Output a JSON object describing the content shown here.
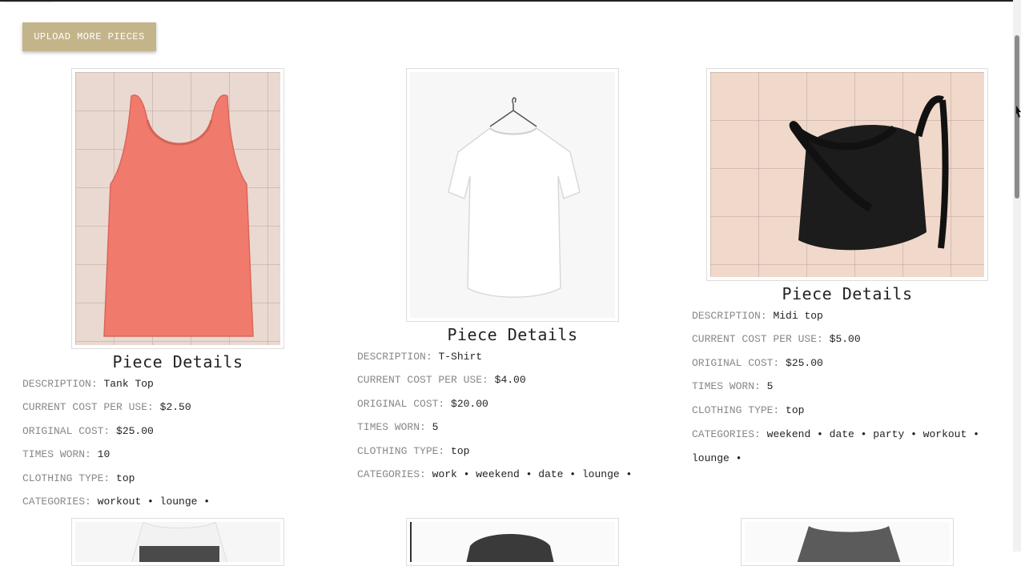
{
  "toolbar": {
    "upload_label": "UPLOAD MORE PIECES"
  },
  "labels": {
    "description": "DESCRIPTION:",
    "cost_per_use": "CURRENT COST PER USE:",
    "original_cost": "ORIGINAL COST:",
    "times_worn": "TIMES WORN:",
    "clothing_type": "CLOTHING TYPE:",
    "categories": "CATEGORIES:"
  },
  "pieces": [
    {
      "title": "Piece Details",
      "image_icon": "tank-top-photo",
      "description": "Tank Top",
      "cost_per_use": "$2.50",
      "original_cost": "$25.00",
      "times_worn": "10",
      "clothing_type": "top",
      "categories": "workout • lounge •"
    },
    {
      "title": "Piece Details",
      "image_icon": "tshirt-photo",
      "description": "T-Shirt",
      "cost_per_use": "$4.00",
      "original_cost": "$20.00",
      "times_worn": "5",
      "clothing_type": "top",
      "categories": "work • weekend • date • lounge •"
    },
    {
      "title": "Piece Details",
      "image_icon": "midi-top-photo",
      "description": "Midi top",
      "cost_per_use": "$5.00",
      "original_cost": "$25.00",
      "times_worn": "5",
      "clothing_type": "top",
      "categories": "weekend • date • party • workout • lounge •"
    }
  ],
  "colors": {
    "button": "#c4b48a",
    "tank": "#f07a6c",
    "midi": "#1c1c1c",
    "bed": "#ecd9cf"
  }
}
